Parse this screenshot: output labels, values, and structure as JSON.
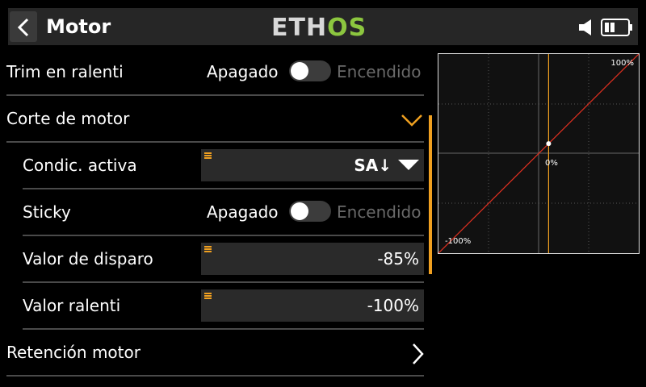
{
  "header": {
    "title": "Motor",
    "logo_part1": "ETH",
    "logo_part2": "OS",
    "icons": [
      "back-icon",
      "speaker-icon",
      "battery-icon"
    ]
  },
  "rows": {
    "idle_trim": {
      "label": "Trim en ralenti",
      "off": "Apagado",
      "on": "Encendido",
      "value": false
    },
    "motor_cut": {
      "label": "Corte de motor",
      "icon": "chevron-down-icon"
    },
    "active_condition": {
      "label": "Condic. activa",
      "value": "SA↓"
    },
    "sticky": {
      "label": "Sticky",
      "off": "Apagado",
      "on": "Encendido",
      "value": false
    },
    "trigger_value": {
      "label": "Valor de disparo",
      "value": "-85%"
    },
    "idle_value": {
      "label": "Valor ralenti",
      "value": "-100%"
    },
    "motor_hold": {
      "label": "Retención motor",
      "icon": "chevron-right-icon"
    }
  },
  "graph": {
    "label_top_right": "100%",
    "label_center": "0%",
    "label_bottom_left": "-100%",
    "cursor_position": 0.1,
    "colors": {
      "curve": "#e03020",
      "cursor": "#f0a020",
      "grid": "#555555"
    }
  },
  "colors": {
    "accent": "#f0a020",
    "brand_green": "#8cc63f"
  }
}
